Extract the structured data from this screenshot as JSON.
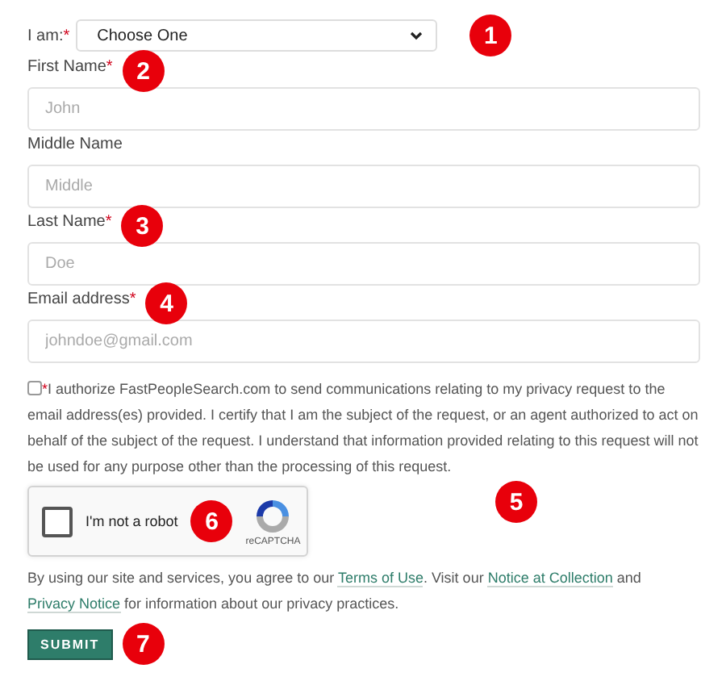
{
  "identity": {
    "label": "I am:",
    "required_mark": "*",
    "value": "Choose One",
    "badge": "1"
  },
  "fields": [
    {
      "label": "First Name",
      "required_mark": "*",
      "placeholder": "John",
      "badge": "2"
    },
    {
      "label": "Middle Name",
      "placeholder": "Middle"
    },
    {
      "label": "Last Name",
      "required_mark": "*",
      "placeholder": "Doe",
      "badge": "3"
    },
    {
      "label": "Email address",
      "required_mark": "*",
      "placeholder": "johndoe@gmail.com",
      "badge": "4"
    }
  ],
  "consent": {
    "checked": false,
    "required_mark": "*",
    "text": "I authorize FastPeopleSearch.com to send communications relating to my privacy request to the email address(es) provided. I certify that I am the subject of the request, or an agent authorized to act on behalf of the subject of the request. I understand that information provided relating to this request will not be used for any purpose other than the processing of this request.",
    "badge": "5"
  },
  "captcha": {
    "checked": false,
    "label": "I'm not a robot",
    "brand": "reCAPTCHA",
    "badge": "6"
  },
  "notice": [
    {
      "kind": "text",
      "text": "By using our site and services, you agree to our "
    },
    {
      "kind": "link",
      "text": "Terms of Use"
    },
    {
      "kind": "text",
      "text": ". Visit our "
    },
    {
      "kind": "link",
      "text": "Notice at Collection"
    },
    {
      "kind": "text",
      "text": " and "
    },
    {
      "kind": "link",
      "text": "Privacy Notice"
    },
    {
      "kind": "text",
      "text": " for information about our privacy practices."
    }
  ],
  "submit": {
    "label": "SUBMIT",
    "badge": "7"
  }
}
